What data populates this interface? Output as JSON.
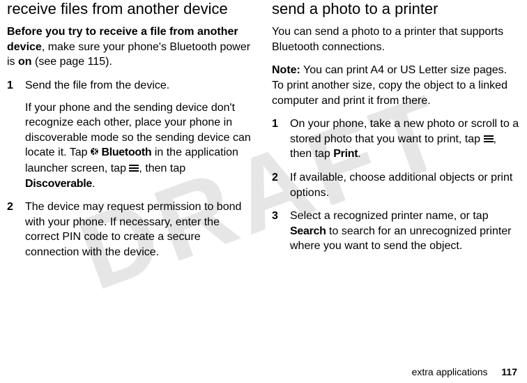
{
  "watermark": "DRAFT",
  "left": {
    "heading": "receive files from another device",
    "intro_lead": "Before you try to receive a file from another device",
    "intro_rest1": ", make sure your phone's Bluetooth power is ",
    "intro_on": "on",
    "intro_rest2": " (see page 115).",
    "steps": [
      {
        "num": "1",
        "para1": "Send the file from the device.",
        "para2a": "If your phone and the sending device don't recognize each other, place your phone in discoverable mode so the sending device can locate it. Tap ",
        "bt_label": "Bluetooth",
        "para2b": " in the application launcher screen, tap ",
        "para2c": ", then tap ",
        "discoverable": "Discoverable",
        "para2d": "."
      },
      {
        "num": "2",
        "para1": "The device may request permission to bond with your phone. If necessary, enter the correct PIN code to create a secure connection with the device."
      }
    ]
  },
  "right": {
    "heading": "send a photo to a printer",
    "intro": "You can send a photo to a printer that supports Bluetooth connections.",
    "note_label": "Note:",
    "note_text": " You can print A4 or US Letter size pages. To print another size, copy the object to a linked computer and print it from there.",
    "steps": [
      {
        "num": "1",
        "para_a": "On your phone, take a new photo or scroll to a stored photo that you want to print, tap ",
        "para_b": ", then tap ",
        "print_label": "Print",
        "para_c": "."
      },
      {
        "num": "2",
        "para": "If available, choose additional objects or print options."
      },
      {
        "num": "3",
        "para_a": "Select a recognized printer name, or tap ",
        "search_label": "Search",
        "para_b": " to search for an unrecognized printer where you want to send the object."
      }
    ]
  },
  "footer": {
    "section": "extra applications",
    "page": "117"
  }
}
